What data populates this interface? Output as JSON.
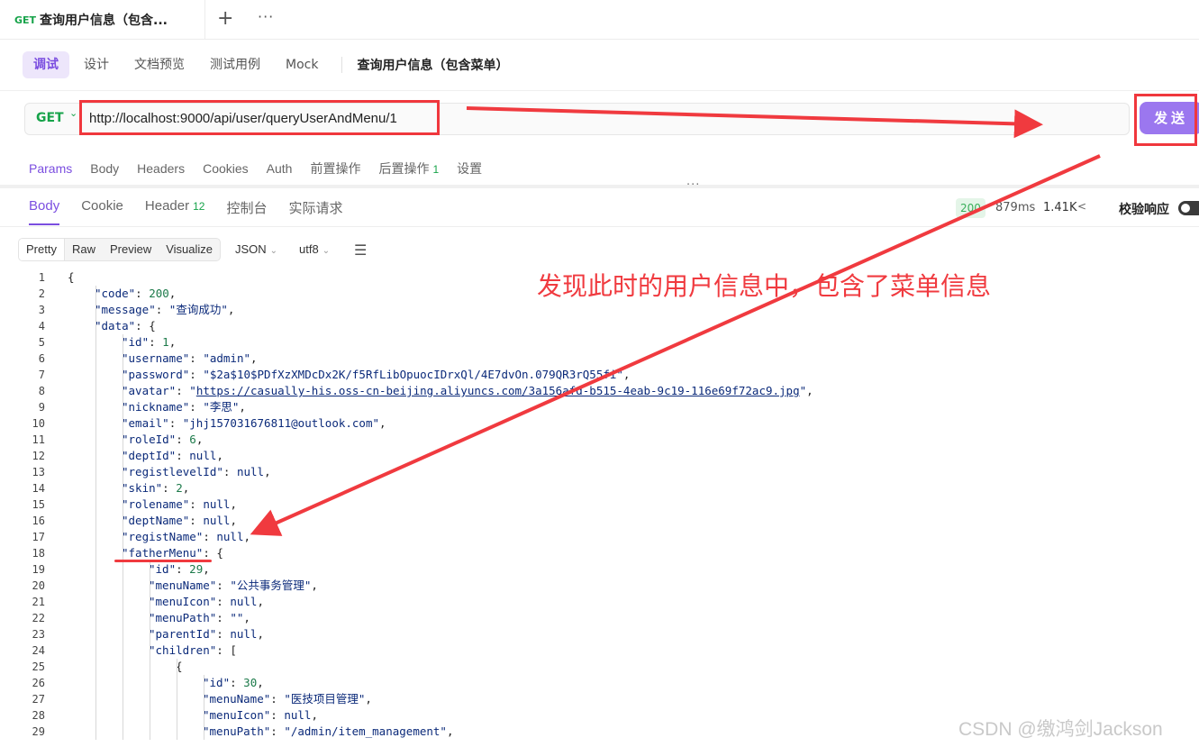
{
  "request_tab": {
    "method": "GET",
    "title": "查询用户信息（包含..."
  },
  "tabbar": {
    "plus": "+",
    "more": "···"
  },
  "mode_tabs": [
    {
      "label": "调试",
      "active": true
    },
    {
      "label": "设计"
    },
    {
      "label": "文档预览"
    },
    {
      "label": "测试用例"
    },
    {
      "label": "Mock"
    }
  ],
  "endpoint_title": "查询用户信息（包含菜单）",
  "url_bar": {
    "method": "GET",
    "url": "http://localhost:9000/api/user/queryUserAndMenu/1",
    "send_label": "发送"
  },
  "request_tabs": [
    {
      "label": "Params",
      "active": true
    },
    {
      "label": "Body"
    },
    {
      "label": "Headers"
    },
    {
      "label": "Cookies"
    },
    {
      "label": "Auth"
    },
    {
      "label": "前置操作"
    },
    {
      "label": "后置操作",
      "count": "1"
    },
    {
      "label": "设置"
    }
  ],
  "response_tabs": [
    {
      "label": "Body",
      "active": true
    },
    {
      "label": "Cookie"
    },
    {
      "label": "Header",
      "count": "12"
    },
    {
      "label": "控制台"
    },
    {
      "label": "实际请求"
    }
  ],
  "response_meta": {
    "status": "200",
    "time": "879ms",
    "size": "1.41K",
    "verify_label": "校验响应"
  },
  "format_tabs": [
    {
      "label": "Pretty",
      "active": true
    },
    {
      "label": "Raw"
    },
    {
      "label": "Preview"
    },
    {
      "label": "Visualize"
    }
  ],
  "format_selects": {
    "type": "JSON",
    "encoding": "utf8"
  },
  "code_lines": [
    {
      "n": "1",
      "indent": 0,
      "parts": [
        [
          "p",
          "{"
        ]
      ]
    },
    {
      "n": "2",
      "indent": 1,
      "parts": [
        [
          "k",
          "\"code\""
        ],
        [
          "p",
          ": "
        ],
        [
          "n",
          "200"
        ],
        [
          "p",
          ","
        ]
      ]
    },
    {
      "n": "3",
      "indent": 1,
      "parts": [
        [
          "k",
          "\"message\""
        ],
        [
          "p",
          ": "
        ],
        [
          "s",
          "\"查询成功\""
        ],
        [
          "p",
          ","
        ]
      ]
    },
    {
      "n": "4",
      "indent": 1,
      "parts": [
        [
          "k",
          "\"data\""
        ],
        [
          "p",
          ": {"
        ]
      ]
    },
    {
      "n": "5",
      "indent": 2,
      "parts": [
        [
          "k",
          "\"id\""
        ],
        [
          "p",
          ": "
        ],
        [
          "n",
          "1"
        ],
        [
          "p",
          ","
        ]
      ]
    },
    {
      "n": "6",
      "indent": 2,
      "parts": [
        [
          "k",
          "\"username\""
        ],
        [
          "p",
          ": "
        ],
        [
          "s",
          "\"admin\""
        ],
        [
          "p",
          ","
        ]
      ]
    },
    {
      "n": "7",
      "indent": 2,
      "parts": [
        [
          "k",
          "\"password\""
        ],
        [
          "p",
          ": "
        ],
        [
          "s",
          "\"$2a$10$PDfXzXMDcDx2K/f5RfLibOpuocIDrxQl/4E7dvOn.079QR3rQ55fi\""
        ],
        [
          "p",
          ","
        ]
      ]
    },
    {
      "n": "8",
      "indent": 2,
      "parts": [
        [
          "k",
          "\"avatar\""
        ],
        [
          "p",
          ": "
        ],
        [
          "s",
          "\""
        ],
        [
          "link",
          "https://casually-his.oss-cn-beijing.aliyuncs.com/3a156afd-b515-4eab-9c19-116e69f72ac9.jpg"
        ],
        [
          "s",
          "\""
        ],
        [
          "p",
          ","
        ]
      ]
    },
    {
      "n": "9",
      "indent": 2,
      "parts": [
        [
          "k",
          "\"nickname\""
        ],
        [
          "p",
          ": "
        ],
        [
          "s",
          "\"李思\""
        ],
        [
          "p",
          ","
        ]
      ]
    },
    {
      "n": "10",
      "indent": 2,
      "parts": [
        [
          "k",
          "\"email\""
        ],
        [
          "p",
          ": "
        ],
        [
          "s",
          "\"jhj157031676811@outlook.com\""
        ],
        [
          "p",
          ","
        ]
      ]
    },
    {
      "n": "11",
      "indent": 2,
      "parts": [
        [
          "k",
          "\"roleId\""
        ],
        [
          "p",
          ": "
        ],
        [
          "n",
          "6"
        ],
        [
          "p",
          ","
        ]
      ]
    },
    {
      "n": "12",
      "indent": 2,
      "parts": [
        [
          "k",
          "\"deptId\""
        ],
        [
          "p",
          ": "
        ],
        [
          "nl",
          "null"
        ],
        [
          "p",
          ","
        ]
      ]
    },
    {
      "n": "13",
      "indent": 2,
      "parts": [
        [
          "k",
          "\"registlevelId\""
        ],
        [
          "p",
          ": "
        ],
        [
          "nl",
          "null"
        ],
        [
          "p",
          ","
        ]
      ]
    },
    {
      "n": "14",
      "indent": 2,
      "parts": [
        [
          "k",
          "\"skin\""
        ],
        [
          "p",
          ": "
        ],
        [
          "n",
          "2"
        ],
        [
          "p",
          ","
        ]
      ]
    },
    {
      "n": "15",
      "indent": 2,
      "parts": [
        [
          "k",
          "\"rolename\""
        ],
        [
          "p",
          ": "
        ],
        [
          "nl",
          "null"
        ],
        [
          "p",
          ","
        ]
      ]
    },
    {
      "n": "16",
      "indent": 2,
      "parts": [
        [
          "k",
          "\"deptName\""
        ],
        [
          "p",
          ": "
        ],
        [
          "nl",
          "null"
        ],
        [
          "p",
          ","
        ]
      ]
    },
    {
      "n": "17",
      "indent": 2,
      "parts": [
        [
          "k",
          "\"registName\""
        ],
        [
          "p",
          ": "
        ],
        [
          "nl",
          "null"
        ],
        [
          "p",
          ","
        ]
      ]
    },
    {
      "n": "18",
      "indent": 2,
      "parts": [
        [
          "k",
          "\"fatherMenu\""
        ],
        [
          "p",
          ": {"
        ]
      ]
    },
    {
      "n": "19",
      "indent": 3,
      "parts": [
        [
          "k",
          "\"id\""
        ],
        [
          "p",
          ": "
        ],
        [
          "n",
          "29"
        ],
        [
          "p",
          ","
        ]
      ]
    },
    {
      "n": "20",
      "indent": 3,
      "parts": [
        [
          "k",
          "\"menuName\""
        ],
        [
          "p",
          ": "
        ],
        [
          "s",
          "\"公共事务管理\""
        ],
        [
          "p",
          ","
        ]
      ]
    },
    {
      "n": "21",
      "indent": 3,
      "parts": [
        [
          "k",
          "\"menuIcon\""
        ],
        [
          "p",
          ": "
        ],
        [
          "nl",
          "null"
        ],
        [
          "p",
          ","
        ]
      ]
    },
    {
      "n": "22",
      "indent": 3,
      "parts": [
        [
          "k",
          "\"menuPath\""
        ],
        [
          "p",
          ": "
        ],
        [
          "s",
          "\"\""
        ],
        [
          "p",
          ","
        ]
      ]
    },
    {
      "n": "23",
      "indent": 3,
      "parts": [
        [
          "k",
          "\"parentId\""
        ],
        [
          "p",
          ": "
        ],
        [
          "nl",
          "null"
        ],
        [
          "p",
          ","
        ]
      ]
    },
    {
      "n": "24",
      "indent": 3,
      "parts": [
        [
          "k",
          "\"children\""
        ],
        [
          "p",
          ": ["
        ]
      ]
    },
    {
      "n": "25",
      "indent": 4,
      "parts": [
        [
          "p",
          "{"
        ]
      ]
    },
    {
      "n": "26",
      "indent": 5,
      "parts": [
        [
          "k",
          "\"id\""
        ],
        [
          "p",
          ": "
        ],
        [
          "n",
          "30"
        ],
        [
          "p",
          ","
        ]
      ]
    },
    {
      "n": "27",
      "indent": 5,
      "parts": [
        [
          "k",
          "\"menuName\""
        ],
        [
          "p",
          ": "
        ],
        [
          "s",
          "\"医技项目管理\""
        ],
        [
          "p",
          ","
        ]
      ]
    },
    {
      "n": "28",
      "indent": 5,
      "parts": [
        [
          "k",
          "\"menuIcon\""
        ],
        [
          "p",
          ": "
        ],
        [
          "nl",
          "null"
        ],
        [
          "p",
          ","
        ]
      ]
    },
    {
      "n": "29",
      "indent": 5,
      "parts": [
        [
          "k",
          "\"menuPath\""
        ],
        [
          "p",
          ": "
        ],
        [
          "s",
          "\"/admin/item_management\""
        ],
        [
          "p",
          ","
        ]
      ]
    }
  ],
  "annotation": {
    "callout": "发现此时的用户信息中，包含了菜单信息",
    "color": "#f03a3f"
  },
  "watermark": "CSDN @缴鸿剑Jackson",
  "colors": {
    "accent": "#7b4ee0",
    "send": "#9b77ef",
    "get": "#17a34a"
  }
}
